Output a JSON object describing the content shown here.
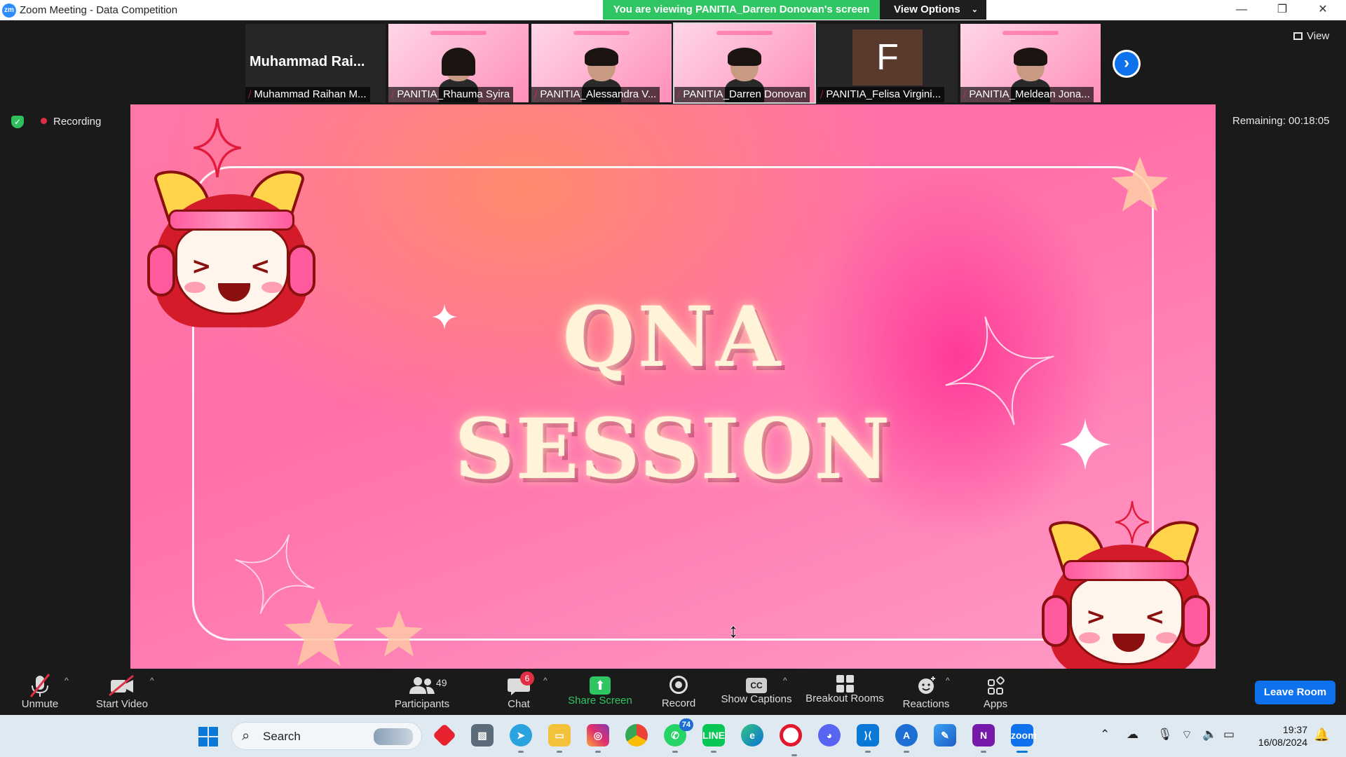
{
  "window": {
    "app_logo_text": "zm",
    "title": "Zoom Meeting - Data Competition",
    "minimize_glyph": "—",
    "restore_glyph": "❐",
    "close_glyph": "✕"
  },
  "banner": {
    "viewing_text": "You are viewing PANITIA_Darren Donovan's screen",
    "view_options_label": "View Options",
    "view_options_chevron": "⌄"
  },
  "gallery": {
    "tiles": [
      {
        "display_name": "Muhammad  Rai...",
        "label": "Muhammad Raihan M..."
      },
      {
        "label": "PANITIA_Rhauma Syira"
      },
      {
        "label": "PANITIA_Alessandra V..."
      },
      {
        "label": "PANITIA_Darren Donovan"
      },
      {
        "avatar_letter": "F",
        "label": "PANITIA_Felisa Virgini..."
      },
      {
        "label": "PANITIA_Meldean Jona..."
      }
    ],
    "next_glyph": "›",
    "view_label": "View",
    "muted_glyph": "⧸"
  },
  "status": {
    "shield_glyph": "✓",
    "recording_label": "Recording",
    "remaining_label": "Remaining: 00:18:05"
  },
  "slide": {
    "line1": "QNA",
    "line2": "SESSION"
  },
  "toolbar": {
    "unmute_label": "Unmute",
    "start_video_label": "Start Video",
    "participants_label": "Participants",
    "participants_count": "49",
    "chat_label": "Chat",
    "chat_badge": "6",
    "share_screen_label": "Share Screen",
    "record_label": "Record",
    "show_captions_label": "Show Captions",
    "cc_text": "CC",
    "breakout_rooms_label": "Breakout Rooms",
    "reactions_label": "Reactions",
    "apps_label": "Apps",
    "leave_label": "Leave Room",
    "caret_glyph": "^"
  },
  "taskbar": {
    "search_label": "Search",
    "whatsapp_badge": "74",
    "apps": [
      "Windows Start",
      "Search",
      "Anydesk",
      "Photos",
      "Telegram",
      "File Explorer",
      "Instagram",
      "Chrome",
      "WhatsApp",
      "LINE",
      "Edge",
      "Opera",
      "Discord",
      "VS Code",
      "App Store",
      "Paint",
      "OneNote",
      "Zoom"
    ],
    "time": "19:37",
    "date": "16/08/2024"
  },
  "colors": {
    "zoom_blue": "#0e72ed",
    "banner_green": "#2fc562",
    "recording_red": "#e02f44",
    "slide_pink": "#ff77a8",
    "toolbar_bg": "#1a1a1a"
  }
}
